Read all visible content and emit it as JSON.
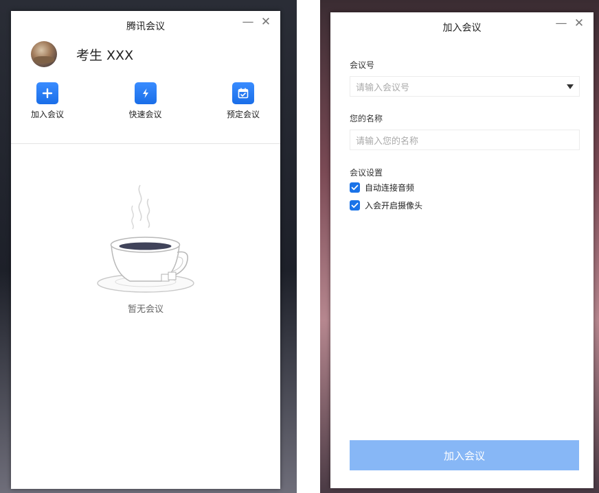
{
  "left_window": {
    "title": "腾讯会议",
    "user_name": "考生 XXX",
    "actions": [
      {
        "label": "加入会议",
        "icon": "plus-icon"
      },
      {
        "label": "快速会议",
        "icon": "lightning-icon"
      },
      {
        "label": "预定会议",
        "icon": "calendar-icon"
      }
    ],
    "empty_text": "暂无会议",
    "empty_icon": "coffee-cup-icon"
  },
  "right_window": {
    "title": "加入会议",
    "meeting_id": {
      "label": "会议号",
      "placeholder": "请输入会议号",
      "value": ""
    },
    "name": {
      "label": "您的名称",
      "placeholder": "请输入您的名称",
      "value": ""
    },
    "settings": {
      "label": "会议设置",
      "options": [
        {
          "label": "自动连接音频",
          "checked": true
        },
        {
          "label": "入会开启摄像头",
          "checked": true
        }
      ]
    },
    "join_button": "加入会议"
  },
  "window_controls": {
    "minimize": "—",
    "close": "✕"
  },
  "colors": {
    "accent": "#1a73e8",
    "button_disabled": "#87b7f6"
  }
}
